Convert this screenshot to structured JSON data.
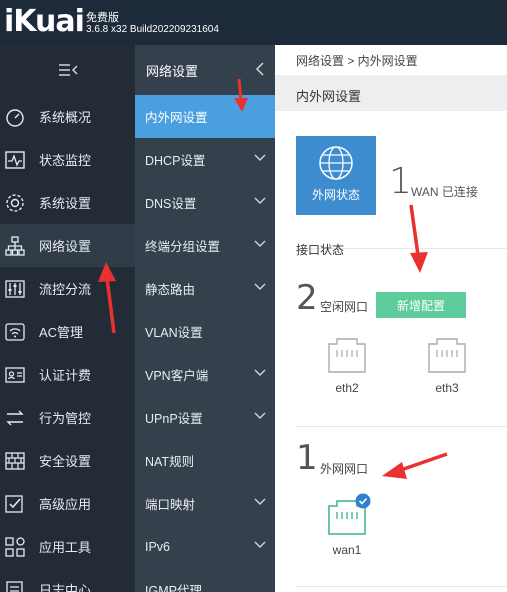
{
  "header": {
    "logo": "iKuai",
    "edition": "免费版",
    "version": "3.6.8 x32 Build202209231604"
  },
  "sidebar": {
    "items": [
      {
        "label": "系统概况",
        "icon": "dashboard-icon"
      },
      {
        "label": "状态监控",
        "icon": "monitor-icon"
      },
      {
        "label": "系统设置",
        "icon": "gear-icon"
      },
      {
        "label": "网络设置",
        "icon": "network-icon"
      },
      {
        "label": "流控分流",
        "icon": "sliders-icon"
      },
      {
        "label": "AC管理",
        "icon": "wifi-icon"
      },
      {
        "label": "认证计费",
        "icon": "id-card-icon"
      },
      {
        "label": "行为管控",
        "icon": "swap-icon"
      },
      {
        "label": "安全设置",
        "icon": "firewall-icon"
      },
      {
        "label": "高级应用",
        "icon": "checkbox-icon"
      },
      {
        "label": "应用工具",
        "icon": "apps-icon"
      },
      {
        "label": "日志中心",
        "icon": "log-icon"
      }
    ]
  },
  "submenu": {
    "title": "网络设置",
    "items": [
      {
        "label": "内外网设置"
      },
      {
        "label": "DHCP设置"
      },
      {
        "label": "DNS设置"
      },
      {
        "label": "终端分组设置"
      },
      {
        "label": "静态路由"
      },
      {
        "label": "VLAN设置"
      },
      {
        "label": "VPN客户端"
      },
      {
        "label": "UPnP设置"
      },
      {
        "label": "NAT规则"
      },
      {
        "label": "端口映射"
      },
      {
        "label": "IPv6"
      },
      {
        "label": "IGMP代理"
      }
    ]
  },
  "main": {
    "breadcrumb": "网络设置 > 内外网设置",
    "title": "内外网设置",
    "wan_status_label": "外网状态",
    "wan_connected_count": "1",
    "wan_connected_text": "WAN 已连接",
    "interface_state_label": "接口状态",
    "idle_count": "2",
    "idle_label": "空闲网口",
    "add_button": "新增配置",
    "idle_ports": [
      "eth2",
      "eth3"
    ],
    "wan_port_count": "1",
    "wan_port_label": "外网网口",
    "wan_ports": [
      "wan1"
    ]
  },
  "colors": {
    "header_bg": "#1c2a3a",
    "sidebar_bg": "#222b36",
    "submenu_bg": "#35404d",
    "submenu_active": "#4a9fe0",
    "wan_box": "#3c8ccf",
    "add_button": "#5ecc9b",
    "annotation_arrow": "#e8322f"
  }
}
